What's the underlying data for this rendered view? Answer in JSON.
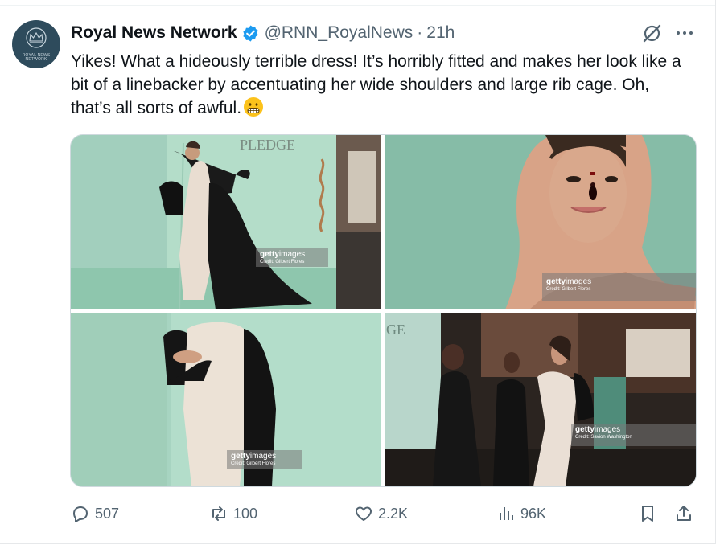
{
  "post": {
    "author_name": "Royal News Network",
    "handle": "@RNN_RoyalNews",
    "separator": "·",
    "time": "21h",
    "avatar_text": "ROYAL NEWS NETWORK",
    "text": "Yikes! What a hideously terrible dress! It’s horribly fitted and makes her look like a bit of a linebacker by accentuating her wide shoulders and large rib cage. Oh, that’s all sorts of awful.",
    "emoji": "grimacing-face",
    "verified_color": "#1d9bf0"
  },
  "media": {
    "images": [
      {
        "sign_text": "PLEDGE",
        "watermark": "getty",
        "watermark_b": "images",
        "credit": "Credit: Gilbert Flores"
      },
      {
        "watermark": "getty",
        "watermark_b": "images",
        "credit": "Credit: Gilbert Flores"
      },
      {
        "watermark": "getty",
        "watermark_b": "images",
        "credit": "Credit: Gilbert Flores"
      },
      {
        "sign_text": "GE",
        "watermark": "getty",
        "watermark_b": "images",
        "credit": "Credit: Savion Washington"
      }
    ]
  },
  "actions": {
    "replies": "507",
    "reposts": "100",
    "likes": "2.2K",
    "views": "96K",
    "icons": [
      "reply-icon",
      "repost-icon",
      "like-icon",
      "views-icon",
      "bookmark-icon",
      "share-icon"
    ]
  }
}
